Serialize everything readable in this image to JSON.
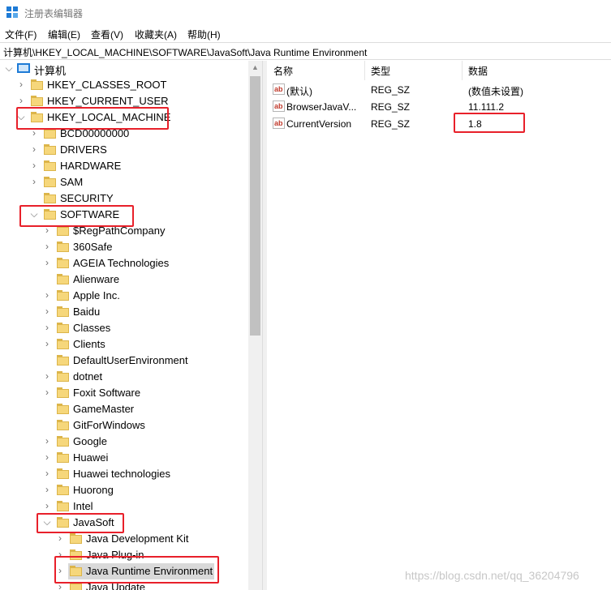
{
  "window": {
    "title": "注册表编辑器",
    "app_icon": "registry-editor-icon"
  },
  "menu": [
    "文件(F)",
    "编辑(E)",
    "查看(V)",
    "收藏夹(A)",
    "帮助(H)"
  ],
  "address": "计算机\\HKEY_LOCAL_MACHINE\\SOFTWARE\\JavaSoft\\Java Runtime Environment",
  "tree": {
    "root": "计算机",
    "items": [
      {
        "label": "HKEY_CLASSES_ROOT"
      },
      {
        "label": "HKEY_CURRENT_USER"
      },
      {
        "label": "HKEY_LOCAL_MACHINE"
      },
      {
        "label": "BCD00000000"
      },
      {
        "label": "DRIVERS"
      },
      {
        "label": "HARDWARE"
      },
      {
        "label": "SAM"
      },
      {
        "label": "SECURITY"
      },
      {
        "label": "SOFTWARE"
      },
      {
        "label": "$RegPathCompany"
      },
      {
        "label": "360Safe"
      },
      {
        "label": "AGEIA Technologies"
      },
      {
        "label": "Alienware"
      },
      {
        "label": "Apple Inc."
      },
      {
        "label": "Baidu"
      },
      {
        "label": "Classes"
      },
      {
        "label": "Clients"
      },
      {
        "label": "DefaultUserEnvironment"
      },
      {
        "label": "dotnet"
      },
      {
        "label": "Foxit Software"
      },
      {
        "label": "GameMaster"
      },
      {
        "label": "GitForWindows"
      },
      {
        "label": "Google"
      },
      {
        "label": "Huawei"
      },
      {
        "label": "Huawei technologies"
      },
      {
        "label": "Huorong"
      },
      {
        "label": "Intel"
      },
      {
        "label": "JavaSoft"
      },
      {
        "label": "Java Development Kit"
      },
      {
        "label": "Java Plug-in"
      },
      {
        "label": "Java Runtime Environment"
      },
      {
        "label": "Java Update"
      }
    ]
  },
  "list": {
    "columns": [
      "名称",
      "类型",
      "数据"
    ],
    "rows": [
      {
        "name": "(默认)",
        "type": "REG_SZ",
        "data": "(数值未设置)"
      },
      {
        "name": "BrowserJavaV...",
        "type": "REG_SZ",
        "data": "11.111.2"
      },
      {
        "name": "CurrentVersion",
        "type": "REG_SZ",
        "data": "1.8"
      }
    ],
    "icon_glyph": "ab"
  },
  "watermark": "https://blog.csdn.net/qq_36204796",
  "colors": {
    "highlight": "#e8202a",
    "folder": "#f6d77b",
    "selected_bg": "#d9d9d9"
  }
}
